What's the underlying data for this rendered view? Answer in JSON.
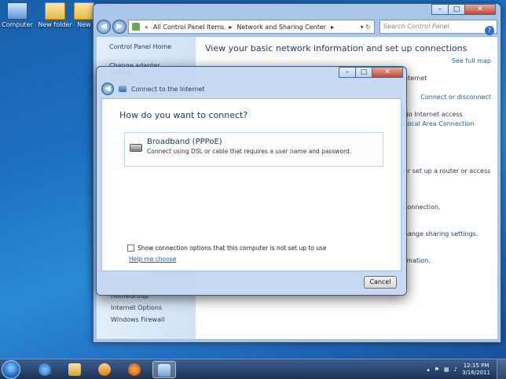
{
  "desktop": {
    "icons": [
      "Computer",
      "New folder",
      "New"
    ]
  },
  "explorer": {
    "address": [
      "All Control Panel Items",
      "Network and Sharing Center"
    ],
    "search_placeholder": "Search Control Panel",
    "sidebar": [
      "Control Panel Home",
      "Change adapter settings"
    ],
    "sidebar_bottom": [
      "HomeGroup",
      "Internet Options",
      "Windows Firewall"
    ],
    "heading": "View your basic network information and set up connections",
    "see_full_map": "See full map",
    "connect_disconnect": "Connect or disconnect",
    "no_internet": "No Internet access",
    "local_area": "Local Area Connection",
    "internet_label": "nternet",
    "partials": [
      "or set up a router or access",
      "connection.",
      "hange sharing settings.",
      "rmation."
    ]
  },
  "dialog": {
    "title": "Connect to the Internet",
    "question": "How do you want to connect?",
    "option_title": "Broadband (PPPoE)",
    "option_desc": "Connect using DSL or cable that requires a user name and password.",
    "checkbox_label": "Show connection options that this computer is not set up to use",
    "help_link": "Help me choose",
    "cancel": "Cancel"
  },
  "taskbar": {
    "time": "12:15 PM",
    "date": "3/16/2011"
  }
}
